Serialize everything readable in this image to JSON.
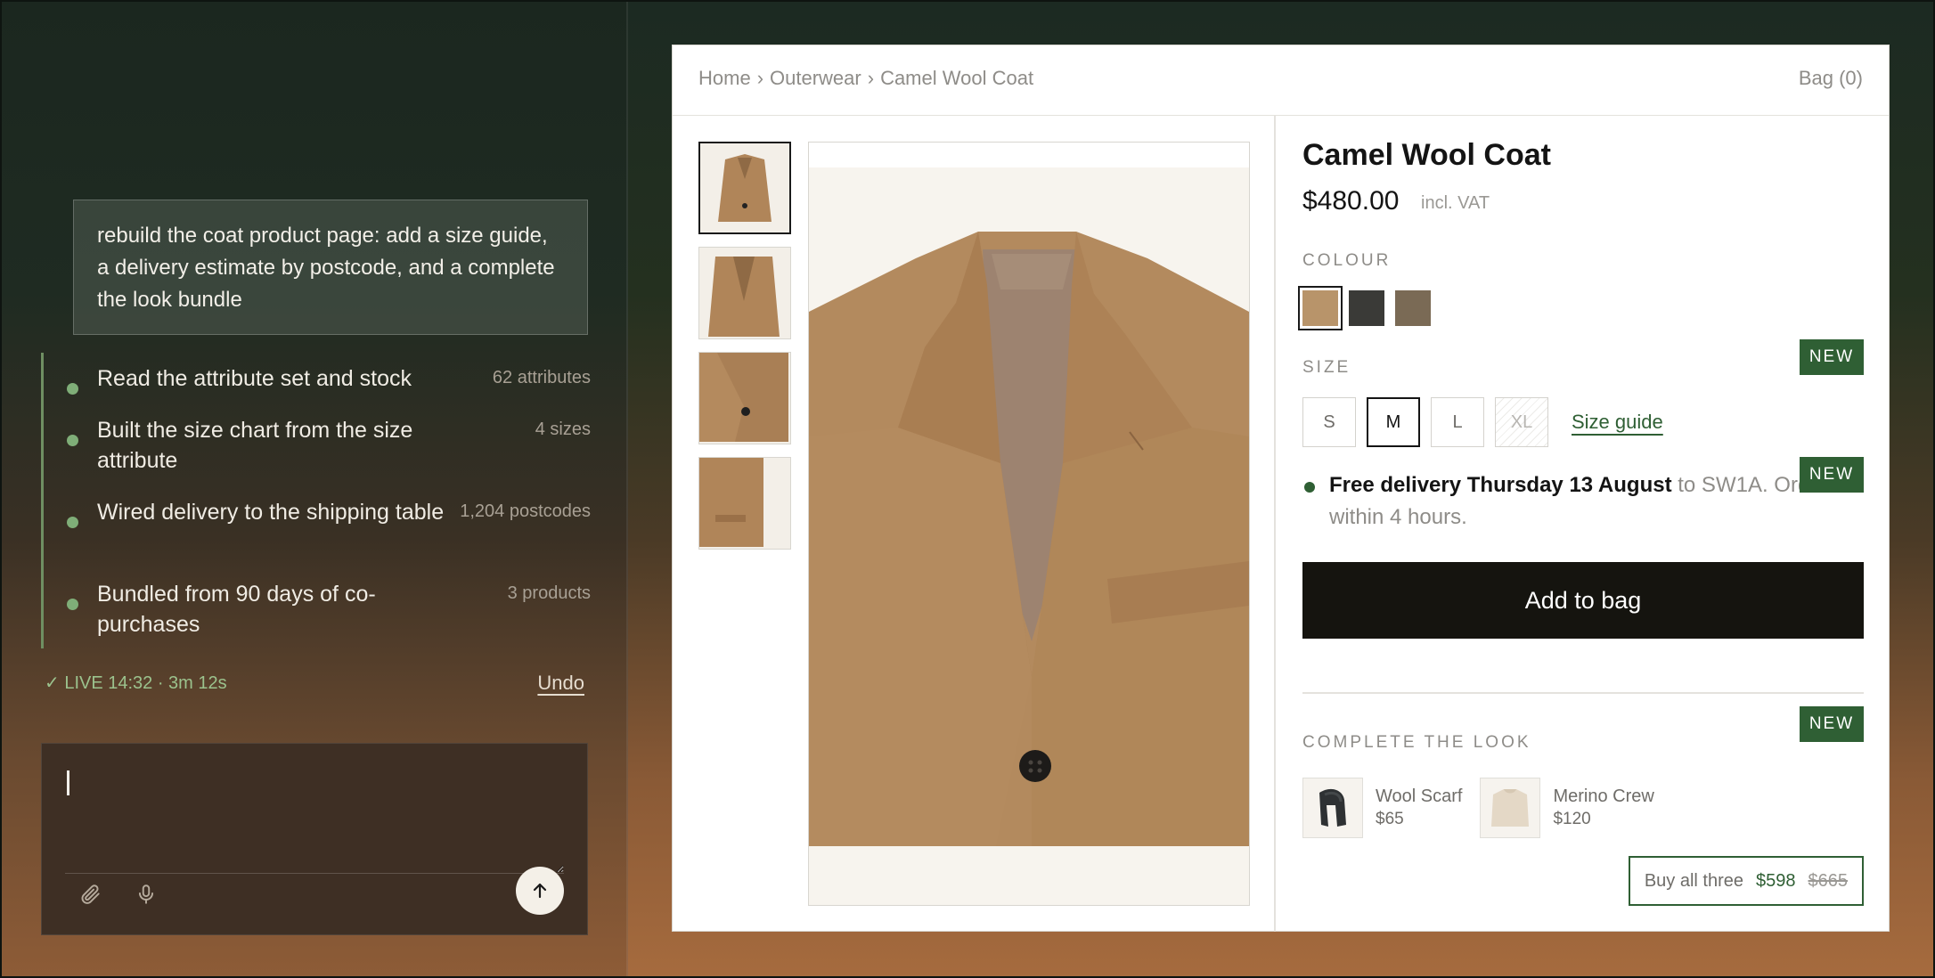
{
  "chat": {
    "prompt": "rebuild the coat product page: add a size guide, a delivery estimate by postcode, and a complete the look bundle",
    "steps": [
      {
        "label": "Read the attribute set and stock",
        "meta": "62 attributes"
      },
      {
        "label": "Built the size chart from the size attribute",
        "meta": "4 sizes"
      },
      {
        "label": "Wired delivery to the shipping table",
        "meta": "1,204 postcodes"
      },
      {
        "label": "Bundled from 90 days of co-purchases",
        "meta": "3 products"
      }
    ],
    "status": "✓ LIVE 14:32 · 3m 12s",
    "undo_label": "Undo",
    "composer_value": ""
  },
  "store": {
    "breadcrumb": [
      "Home",
      "Outerwear",
      "Camel Wool Coat"
    ],
    "breadcrumb_sep": "›",
    "bag_label": "Bag (0)"
  },
  "product": {
    "title": "Camel Wool Coat",
    "price": "$480.00",
    "vat": "incl. VAT",
    "colour_label": "COLOUR",
    "colours": [
      "#b8946a",
      "#3a3a37",
      "#7a6a55"
    ],
    "size_label": "SIZE",
    "sizes": [
      "S",
      "M",
      "L",
      "XL"
    ],
    "size_guide_label": "Size guide",
    "new_badge": "NEW",
    "delivery_strong": "Free delivery Thursday 13 August",
    "delivery_rest": " to SW1A. Order within 4 hours.",
    "add_to_bag_label": "Add to bag",
    "complete_look_label": "COMPLETE THE LOOK",
    "bundle": [
      {
        "name": "Wool Scarf",
        "price": "$65"
      },
      {
        "name": "Merino Crew",
        "price": "$120"
      }
    ],
    "buy_all_label": "Buy all three",
    "buy_all_price": "$598",
    "buy_all_old_price": "$665"
  },
  "colors": {
    "accent_green": "#2f5f34",
    "button_dark": "#15140f",
    "coat": "#b08559"
  },
  "icons": {
    "attach": "paperclip-icon",
    "mic": "microphone-icon",
    "send": "arrow-up-icon"
  }
}
